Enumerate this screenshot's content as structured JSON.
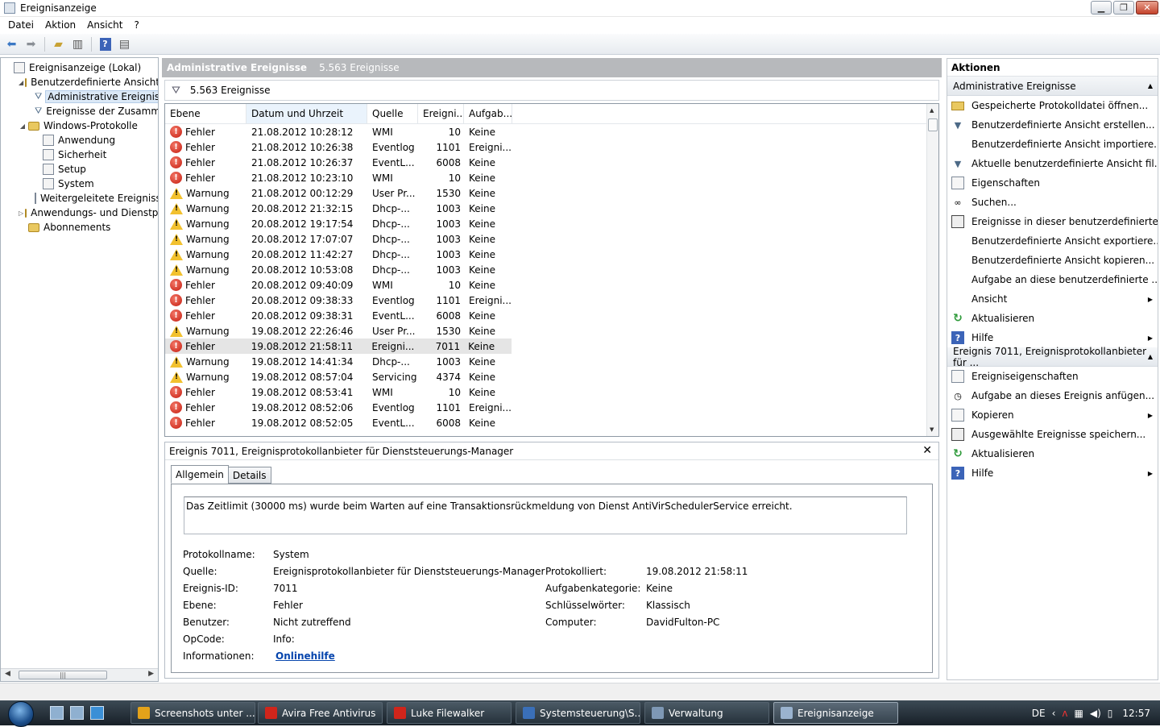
{
  "window": {
    "title": "Ereignisanzeige"
  },
  "menu": [
    "Datei",
    "Aktion",
    "Ansicht",
    "?"
  ],
  "tree": [
    {
      "label": "Ereignisanzeige (Lokal)",
      "level": 0,
      "icon": "computer-icon",
      "twisty": ""
    },
    {
      "label": "Benutzerdefinierte Ansichten",
      "level": 1,
      "icon": "folder-icon",
      "twisty": "◢"
    },
    {
      "label": "Administrative Ereignisse",
      "level": 2,
      "icon": "funnel-icon",
      "twisty": "",
      "selected": true
    },
    {
      "label": "Ereignisse der Zusammenfassung",
      "level": 2,
      "icon": "funnel-icon",
      "twisty": ""
    },
    {
      "label": "Windows-Protokolle",
      "level": 1,
      "icon": "folder-icon",
      "twisty": "◢"
    },
    {
      "label": "Anwendung",
      "level": 2,
      "icon": "log-icon",
      "twisty": ""
    },
    {
      "label": "Sicherheit",
      "level": 2,
      "icon": "log-icon",
      "twisty": ""
    },
    {
      "label": "Setup",
      "level": 2,
      "icon": "log-icon",
      "twisty": ""
    },
    {
      "label": "System",
      "level": 2,
      "icon": "log-icon",
      "twisty": ""
    },
    {
      "label": "Weitergeleitete Ereignisse",
      "level": 2,
      "icon": "log-icon",
      "twisty": ""
    },
    {
      "label": "Anwendungs- und Dienstprotokolle",
      "level": 1,
      "icon": "folder-icon",
      "twisty": "▷"
    },
    {
      "label": "Abonnements",
      "level": 1,
      "icon": "subscription-icon",
      "twisty": ""
    }
  ],
  "center": {
    "title": "Administrative Ereignisse",
    "count": "5.563 Ereignisse",
    "filter_text": "5.563 Ereignisse"
  },
  "grid": {
    "columns": [
      "Ebene",
      "Datum und Uhrzeit",
      "Quelle",
      "Ereigni...",
      "Aufgab..."
    ],
    "rows": [
      {
        "level": "Fehler",
        "type": "err",
        "date": "21.08.2012 10:28:12",
        "source": "WMI",
        "id": "10",
        "task": "Keine"
      },
      {
        "level": "Fehler",
        "type": "err",
        "date": "21.08.2012 10:26:38",
        "source": "Eventlog",
        "id": "1101",
        "task": "Ereigni..."
      },
      {
        "level": "Fehler",
        "type": "err",
        "date": "21.08.2012 10:26:37",
        "source": "EventL...",
        "id": "6008",
        "task": "Keine"
      },
      {
        "level": "Fehler",
        "type": "err",
        "date": "21.08.2012 10:23:10",
        "source": "WMI",
        "id": "10",
        "task": "Keine"
      },
      {
        "level": "Warnung",
        "type": "warn",
        "date": "21.08.2012 00:12:29",
        "source": "User Pr...",
        "id": "1530",
        "task": "Keine"
      },
      {
        "level": "Warnung",
        "type": "warn",
        "date": "20.08.2012 21:32:15",
        "source": "Dhcp-...",
        "id": "1003",
        "task": "Keine"
      },
      {
        "level": "Warnung",
        "type": "warn",
        "date": "20.08.2012 19:17:54",
        "source": "Dhcp-...",
        "id": "1003",
        "task": "Keine"
      },
      {
        "level": "Warnung",
        "type": "warn",
        "date": "20.08.2012 17:07:07",
        "source": "Dhcp-...",
        "id": "1003",
        "task": "Keine"
      },
      {
        "level": "Warnung",
        "type": "warn",
        "date": "20.08.2012 11:42:27",
        "source": "Dhcp-...",
        "id": "1003",
        "task": "Keine"
      },
      {
        "level": "Warnung",
        "type": "warn",
        "date": "20.08.2012 10:53:08",
        "source": "Dhcp-...",
        "id": "1003",
        "task": "Keine"
      },
      {
        "level": "Fehler",
        "type": "err",
        "date": "20.08.2012 09:40:09",
        "source": "WMI",
        "id": "10",
        "task": "Keine"
      },
      {
        "level": "Fehler",
        "type": "err",
        "date": "20.08.2012 09:38:33",
        "source": "Eventlog",
        "id": "1101",
        "task": "Ereigni..."
      },
      {
        "level": "Fehler",
        "type": "err",
        "date": "20.08.2012 09:38:31",
        "source": "EventL...",
        "id": "6008",
        "task": "Keine"
      },
      {
        "level": "Warnung",
        "type": "warn",
        "date": "19.08.2012 22:26:46",
        "source": "User Pr...",
        "id": "1530",
        "task": "Keine"
      },
      {
        "level": "Fehler",
        "type": "err",
        "date": "19.08.2012 21:58:11",
        "source": "Ereigni...",
        "id": "7011",
        "task": "Keine",
        "selected": true
      },
      {
        "level": "Warnung",
        "type": "warn",
        "date": "19.08.2012 14:41:34",
        "source": "Dhcp-...",
        "id": "1003",
        "task": "Keine"
      },
      {
        "level": "Warnung",
        "type": "warn",
        "date": "19.08.2012 08:57:04",
        "source": "Servicing",
        "id": "4374",
        "task": "Keine"
      },
      {
        "level": "Fehler",
        "type": "err",
        "date": "19.08.2012 08:53:41",
        "source": "WMI",
        "id": "10",
        "task": "Keine"
      },
      {
        "level": "Fehler",
        "type": "err",
        "date": "19.08.2012 08:52:06",
        "source": "Eventlog",
        "id": "1101",
        "task": "Ereigni..."
      },
      {
        "level": "Fehler",
        "type": "err",
        "date": "19.08.2012 08:52:05",
        "source": "EventL...",
        "id": "6008",
        "task": "Keine"
      }
    ]
  },
  "detail": {
    "title": "Ereignis 7011, Ereignisprotokollanbieter für Dienststeuerungs-Manager",
    "tabs": [
      "Allgemein",
      "Details"
    ],
    "message": "Das Zeitlimit (30000 ms) wurde beim Warten auf eine Transaktionsrückmeldung von Dienst AntiVirSchedulerService erreicht.",
    "labels": {
      "protokollname": "Protokollname:",
      "quelle": "Quelle:",
      "ereignis_id": "Ereignis-ID:",
      "ebene": "Ebene:",
      "benutzer": "Benutzer:",
      "opcode": "OpCode:",
      "informationen": "Informationen:",
      "protokolliert": "Protokolliert:",
      "aufgabenkategorie": "Aufgabenkategorie:",
      "schluesselwoerter": "Schlüsselwörter:",
      "computer": "Computer:"
    },
    "values": {
      "protokollname": "System",
      "quelle": "Ereignisprotokollanbieter für Dienststeuerungs-Manager",
      "ereignis_id": "7011",
      "ebene": "Fehler",
      "benutzer": "Nicht zutreffend",
      "opcode": "Info:",
      "informationen": "Onlinehilfe",
      "protokolliert": "19.08.2012 21:58:11",
      "aufgabenkategorie": "Keine",
      "schluesselwoerter": "Klassisch",
      "computer": "DavidFulton-PC"
    }
  },
  "actions": {
    "header": "Aktionen",
    "section1": "Administrative Ereignisse",
    "items1": [
      {
        "label": "Gespeicherte Protokolldatei öffnen...",
        "icon": "open-folder-icon",
        "glyph": "",
        "cls": "folder"
      },
      {
        "label": "Benutzerdefinierte Ansicht erstellen...",
        "icon": "create-filter-icon",
        "glyph": "▼",
        "cls": ""
      },
      {
        "label": "Benutzerdefinierte Ansicht importiere...",
        "icon": "",
        "glyph": "",
        "cls": ""
      },
      {
        "label": "Aktuelle benutzerdefinierte Ansicht fil...",
        "icon": "filter-icon",
        "glyph": "▼",
        "cls": ""
      },
      {
        "label": "Eigenschaften",
        "icon": "properties-icon",
        "glyph": "",
        "cls": "doc"
      },
      {
        "label": "Suchen...",
        "icon": "binoculars-icon",
        "glyph": "∞",
        "cls": ""
      },
      {
        "label": "Ereignisse in dieser benutzerdefinierte...",
        "icon": "save-icon",
        "glyph": "",
        "cls": "disk"
      },
      {
        "label": "Benutzerdefinierte Ansicht exportiere...",
        "icon": "",
        "glyph": "",
        "cls": ""
      },
      {
        "label": "Benutzerdefinierte Ansicht kopieren...",
        "icon": "",
        "glyph": "",
        "cls": ""
      },
      {
        "label": "Aufgabe an diese benutzerdefinierte ...",
        "icon": "",
        "glyph": "",
        "cls": ""
      },
      {
        "label": "Ansicht",
        "icon": "",
        "glyph": "",
        "cls": "",
        "submenu": true
      },
      {
        "label": "Aktualisieren",
        "icon": "refresh-icon",
        "glyph": "↻",
        "cls": "refresh"
      },
      {
        "label": "Hilfe",
        "icon": "help-icon",
        "glyph": "?",
        "cls": "help",
        "submenu": true
      }
    ],
    "section2": "Ereignis 7011, Ereignisprotokollanbieter für ...",
    "items2": [
      {
        "label": "Ereigniseigenschaften",
        "icon": "event-properties-icon",
        "glyph": "",
        "cls": "doc"
      },
      {
        "label": "Aufgabe an dieses Ereignis anfügen...",
        "icon": "attach-task-icon",
        "glyph": "◷",
        "cls": ""
      },
      {
        "label": "Kopieren",
        "icon": "copy-icon",
        "glyph": "",
        "cls": "doc",
        "submenu": true
      },
      {
        "label": "Ausgewählte Ereignisse speichern...",
        "icon": "save-icon",
        "glyph": "",
        "cls": "disk"
      },
      {
        "label": "Aktualisieren",
        "icon": "refresh-icon",
        "glyph": "↻",
        "cls": "refresh"
      },
      {
        "label": "Hilfe",
        "icon": "help-icon",
        "glyph": "?",
        "cls": "help",
        "submenu": true
      }
    ]
  },
  "taskbar": {
    "tasks": [
      {
        "label": "Screenshots unter ...",
        "color": "#e3a21a"
      },
      {
        "label": "Avira Free Antivirus",
        "color": "#d0251b"
      },
      {
        "label": "Luke Filewalker",
        "color": "#d0251b"
      },
      {
        "label": "Systemsteuerung\\S...",
        "color": "#3a6fb8"
      },
      {
        "label": "Verwaltung",
        "color": "#7e98b5"
      },
      {
        "label": "Ereignisanzeige",
        "color": "#9ab3cf",
        "active": true
      }
    ],
    "lang": "DE",
    "clock": "12:57"
  }
}
